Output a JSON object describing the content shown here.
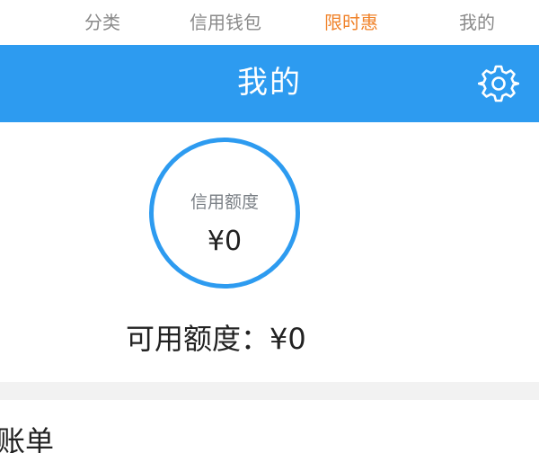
{
  "top_tabs": [
    {
      "label": "分类",
      "active": false
    },
    {
      "label": "信用钱包",
      "active": false
    },
    {
      "label": "限时惠",
      "active": true
    },
    {
      "label": "我的",
      "active": false
    }
  ],
  "header": {
    "title": "我的",
    "settings_icon": "gear-icon"
  },
  "credit": {
    "label": "信用额度",
    "value": "¥0"
  },
  "available": {
    "text": "可用额度：¥0"
  },
  "bill": {
    "title": "账单"
  },
  "colors": {
    "primary_blue": "#2d9bf0",
    "active_tab": "#f0832b",
    "inactive_tab": "#8a8a8a"
  }
}
